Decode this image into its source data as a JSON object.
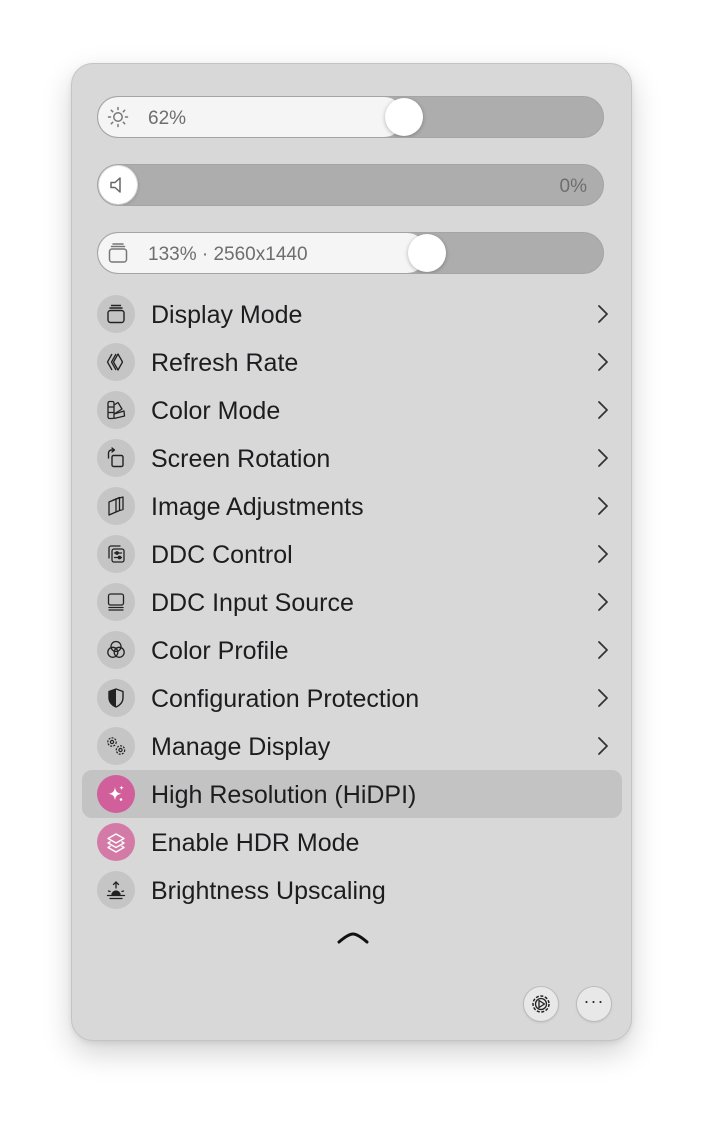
{
  "sliders": {
    "brightness": {
      "value_text": "62%",
      "level": 0.62,
      "icon": "sun-icon"
    },
    "volume": {
      "value_text": "0%",
      "level": 0.0,
      "icon": "speaker-icon"
    },
    "resolution": {
      "value_text": "133% · 2560x1440",
      "level": 0.65,
      "icon": "display-stack-icon"
    }
  },
  "menu": {
    "items": [
      {
        "label": "Display Mode",
        "icon": "display-stack-icon",
        "submenu": true
      },
      {
        "label": "Refresh Rate",
        "icon": "refresh-rate-icon",
        "submenu": true
      },
      {
        "label": "Color Mode",
        "icon": "swatches-icon",
        "submenu": true
      },
      {
        "label": "Screen Rotation",
        "icon": "rotate-icon",
        "submenu": true
      },
      {
        "label": "Image Adjustments",
        "icon": "image-adjust-icon",
        "submenu": true
      },
      {
        "label": "DDC Control",
        "icon": "ddc-control-icon",
        "submenu": true
      },
      {
        "label": "DDC Input Source",
        "icon": "input-source-icon",
        "submenu": true
      },
      {
        "label": "Color Profile",
        "icon": "color-circles-icon",
        "submenu": true
      },
      {
        "label": "Configuration Protection",
        "icon": "shield-icon",
        "submenu": true
      },
      {
        "label": "Manage Display",
        "icon": "gears-icon",
        "submenu": true
      },
      {
        "label": "High Resolution (HiDPI)",
        "icon": "sparkle-icon",
        "submenu": false,
        "active": true,
        "highlighted": true
      },
      {
        "label": "Enable HDR Mode",
        "icon": "layers-icon",
        "submenu": false,
        "active": true
      },
      {
        "label": "Brightness Upscaling",
        "icon": "sunrise-icon",
        "submenu": false
      }
    ]
  },
  "footer": {
    "settings_icon": "gear-icon",
    "more_icon": "ellipsis-icon",
    "more_label": "···",
    "collapse_icon": "chevron-up-icon"
  },
  "colors": {
    "accent_pink": "#d05f9b",
    "accent_pink_light": "#d47aa7",
    "panel_bg": "#d8d8d8"
  }
}
